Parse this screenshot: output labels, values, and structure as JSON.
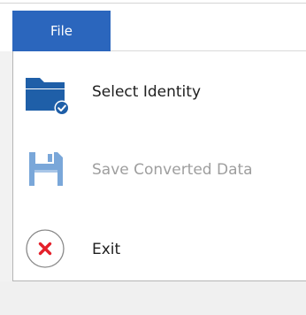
{
  "file_tab": {
    "label": "File"
  },
  "menu": {
    "items": [
      {
        "label": "Select Identity",
        "icon": "folder-check-icon",
        "enabled": true
      },
      {
        "label": "Save Converted Data",
        "icon": "floppy-disk-icon",
        "enabled": false
      },
      {
        "label": "Exit",
        "icon": "exit-x-icon",
        "enabled": true
      }
    ]
  },
  "colors": {
    "accent": "#2b66bd",
    "folder_blue": "#1f5fa8",
    "disabled_blue": "#7aa7d9",
    "exit_red": "#e4202a",
    "disabled_text": "#9e9e9e"
  }
}
